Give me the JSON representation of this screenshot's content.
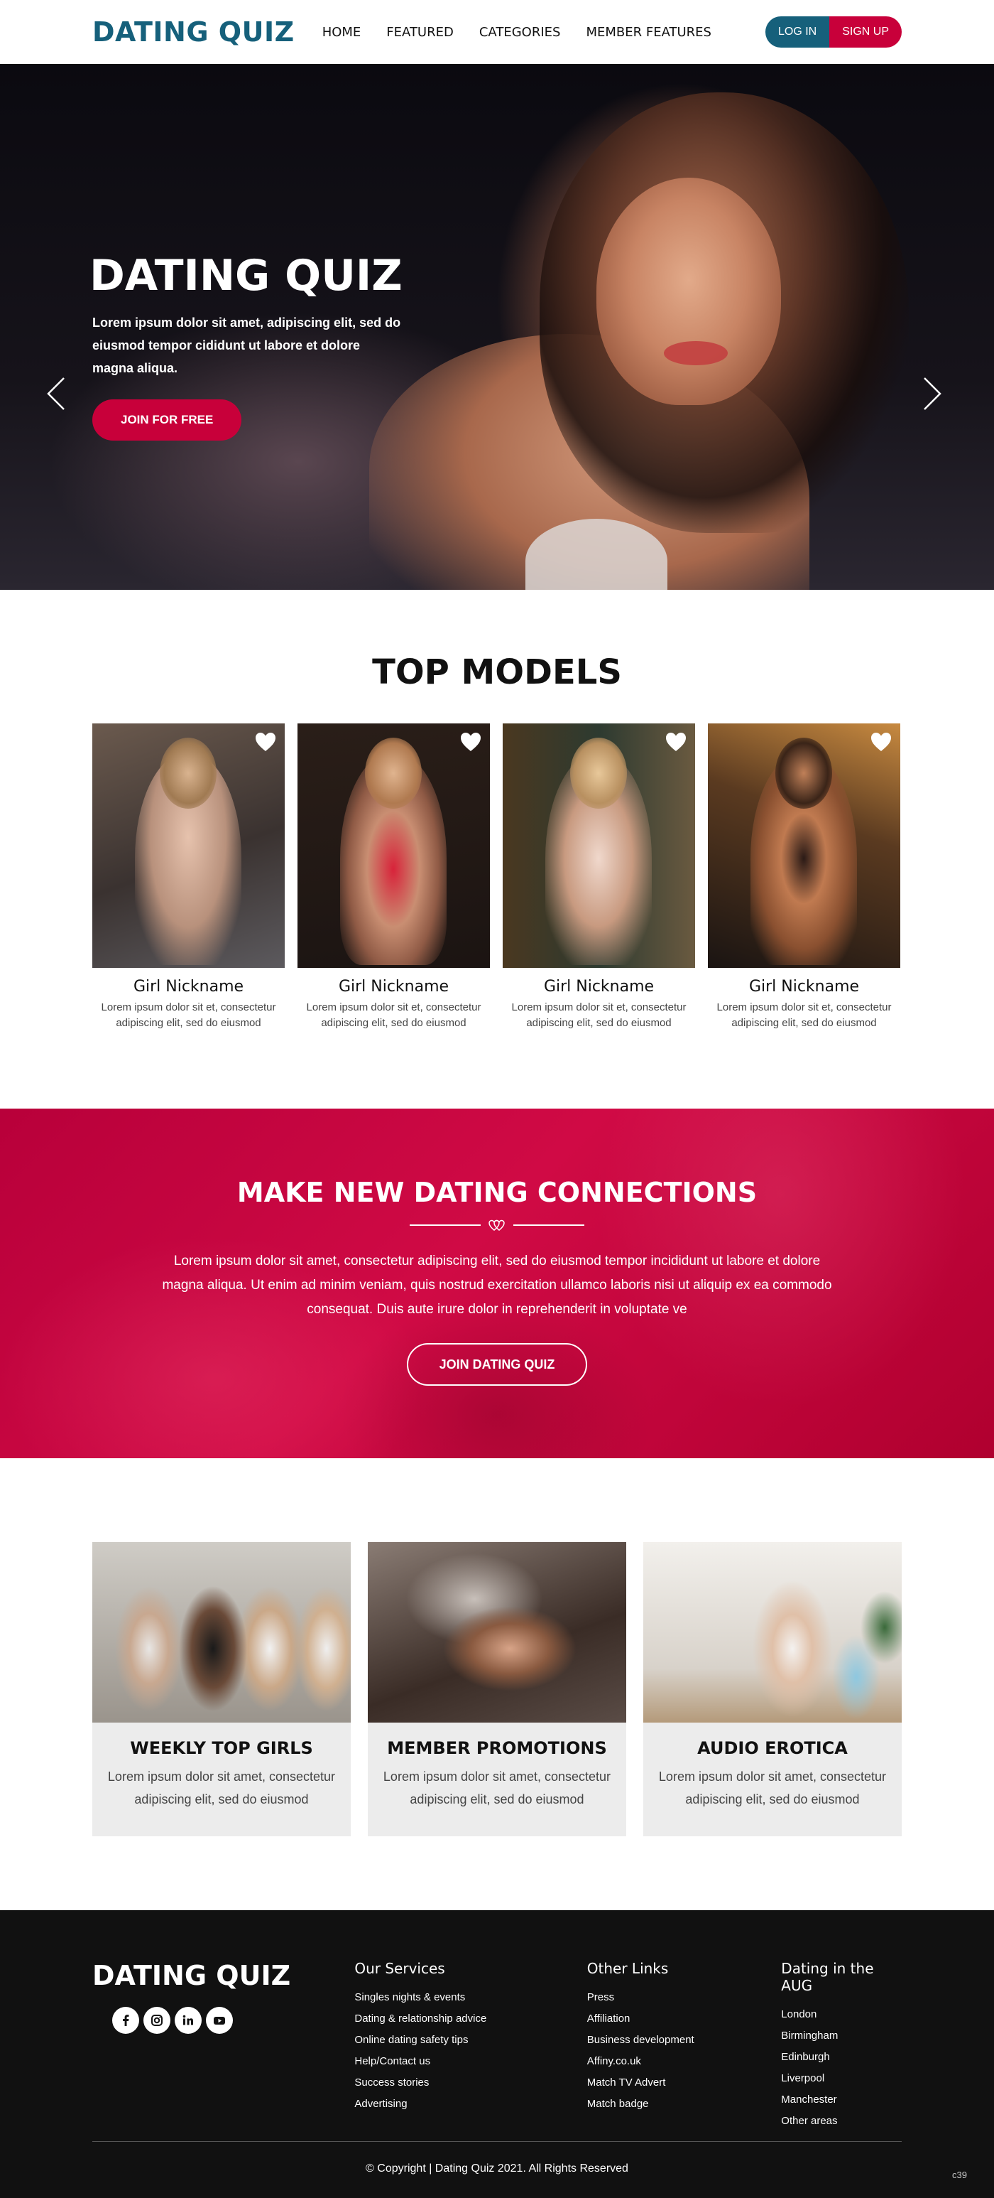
{
  "header": {
    "logo": "DATING QUIZ",
    "nav": [
      "HOME",
      "FEATURED",
      "CATEGORIES",
      "MEMBER FEATURES"
    ],
    "login": "LOG IN",
    "signup": "SIGN UP"
  },
  "hero": {
    "title": "DATING QUIZ",
    "text": "Lorem ipsum dolor sit amet, adipiscing elit, sed do eiusmod tempor cididunt ut labore et dolore magna aliqua.",
    "button": "JOIN FOR FREE",
    "slides_total": 4,
    "active_slide": 3
  },
  "models": {
    "title": "TOP MODELS",
    "items": [
      {
        "name": "Girl Nickname",
        "desc": "Lorem ipsum dolor sit et, consectetur adipiscing elit, sed do eiusmod"
      },
      {
        "name": "Girl Nickname",
        "desc": "Lorem ipsum dolor sit et, consectetur adipiscing elit, sed do eiusmod"
      },
      {
        "name": "Girl Nickname",
        "desc": "Lorem ipsum dolor sit et, consectetur adipiscing elit, sed do eiusmod"
      },
      {
        "name": "Girl Nickname",
        "desc": "Lorem ipsum dolor sit et, consectetur adipiscing elit, sed do eiusmod"
      }
    ]
  },
  "connections": {
    "title": "MAKE NEW DATING CONNECTIONS",
    "text": "Lorem ipsum dolor sit amet, consectetur adipiscing elit, sed do eiusmod tempor incididunt ut labore et dolore magna aliqua. Ut enim ad minim veniam, quis nostrud exercitation ullamco laboris nisi ut aliquip ex ea commodo consequat. Duis aute irure dolor in reprehenderit in voluptate ve",
    "button": "JOIN DATING QUIZ"
  },
  "features": [
    {
      "title": "WEEKLY TOP GIRLS",
      "desc": "Lorem ipsum dolor sit amet, consectetur adipiscing elit, sed do eiusmod"
    },
    {
      "title": "MEMBER PROMOTIONS",
      "desc": "Lorem ipsum dolor sit amet, consectetur adipiscing elit, sed do eiusmod"
    },
    {
      "title": "AUDIO EROTICA",
      "desc": "Lorem ipsum dolor sit amet, consectetur adipiscing elit, sed do eiusmod"
    }
  ],
  "footer": {
    "logo": "DATING QUIZ",
    "socials": [
      "facebook-icon",
      "instagram-icon",
      "linkedin-icon",
      "youtube-icon"
    ],
    "columns": [
      {
        "title": "Our Services",
        "links": [
          "Singles nights & events",
          "Dating & relationship advice",
          "Online dating safety tips",
          "Help/Contact us",
          "Success stories",
          "Advertising"
        ]
      },
      {
        "title": "Other Links",
        "links": [
          "Press",
          "Affiliation",
          "Business development",
          "Affiny.co.uk",
          "Match TV Advert",
          "Match badge"
        ]
      },
      {
        "title": "Dating in the AUG",
        "links": [
          "London",
          "Birmingham",
          "Edinburgh",
          "Liverpool",
          "Manchester",
          "Other areas"
        ]
      }
    ],
    "copyright": "© Copyright | Dating Quiz 2021. All Rights Reserved",
    "tag": "c39"
  },
  "colors": {
    "brand_blue": "#16607b",
    "brand_red": "#c8003a",
    "footer_bg": "#111111"
  }
}
